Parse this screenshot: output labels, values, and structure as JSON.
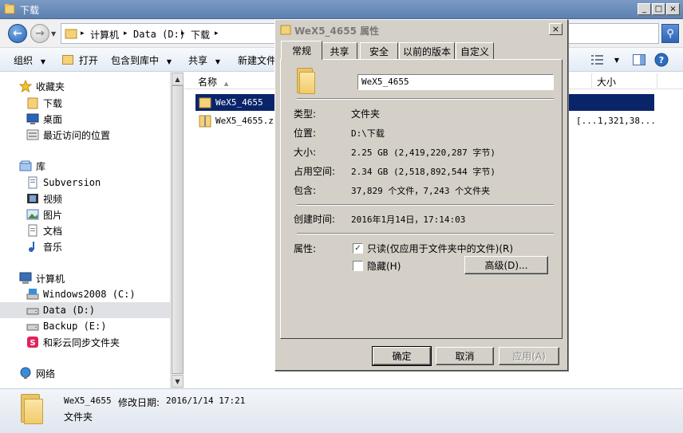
{
  "window": {
    "title": "下载",
    "buttons": {
      "minimize": "_",
      "maximize": "□",
      "close": "×"
    }
  },
  "address": {
    "crumbs": [
      "计算机",
      "Data (D:)",
      "下载"
    ],
    "separator": "▸"
  },
  "toolbar": {
    "organize": "组织",
    "open": "打开",
    "include_in_library": "包含到库中",
    "share": "共享",
    "new_folder": "新建文件",
    "dropdown_arrow": "▼"
  },
  "nav": {
    "favorites": "收藏夹",
    "downloads": "下载",
    "desktop": "桌面",
    "recent": "最近访问的位置",
    "libraries": "库",
    "subversion": "Subversion",
    "videos": "视频",
    "pictures": "图片",
    "documents": "文档",
    "music": "音乐",
    "computer": "计算机",
    "drive_c": "Windows2008 (C:)",
    "drive_d": "Data (D:)",
    "drive_e": "Backup (E:)",
    "cloud": "和彩云同步文件夹",
    "network": "网络"
  },
  "list": {
    "col_name": "名称",
    "col_size": "大小",
    "rows": [
      {
        "name": "WeX5_4655",
        "type_frag": "",
        "size": ""
      },
      {
        "name": "WeX5_4655.zip",
        "type_frag": "[...",
        "size": "1,321,38..."
      }
    ]
  },
  "details": {
    "name": "WeX5_4655",
    "modified_label": "修改日期:",
    "modified_value": "2016/1/14 17:21",
    "type": "文件夹"
  },
  "dialog": {
    "title": "WeX5_4655 属性",
    "tabs": [
      "常规",
      "共享",
      "安全",
      "以前的版本",
      "自定义"
    ],
    "folder_name": "WeX5_4655",
    "labels": {
      "type": "类型:",
      "location": "位置:",
      "size": "大小:",
      "size_on_disk": "占用空间:",
      "contains": "包含:",
      "created": "创建时间:",
      "attributes": "属性:"
    },
    "values": {
      "type": "文件夹",
      "location": "D:\\下载",
      "size": "2.25 GB (2,419,220,287 字节)",
      "size_on_disk": "2.34 GB (2,518,892,544 字节)",
      "contains": "37,829 个文件，7,243 个文件夹",
      "created": "2016年1月14日，17:14:03"
    },
    "readonly_label": "只读(仅应用于文件夹中的文件)(R)",
    "hidden_label": "隐藏(H)",
    "advanced_button": "高级(D)...",
    "ok_button": "确定",
    "cancel_button": "取消",
    "apply_button": "应用(A)",
    "close_glyph": "×"
  }
}
